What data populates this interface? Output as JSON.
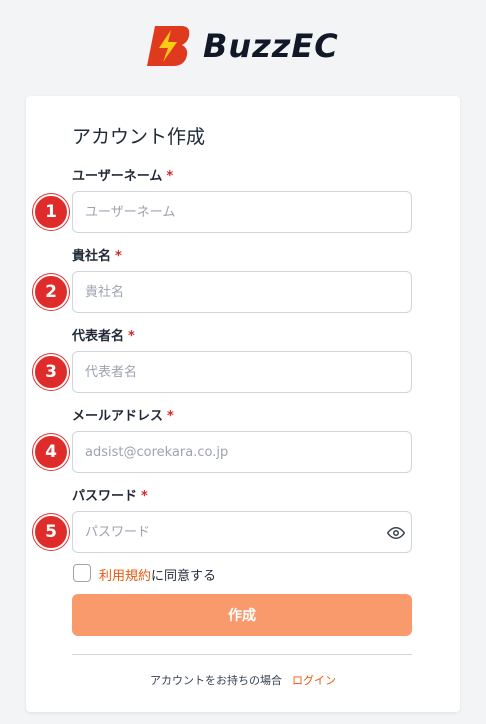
{
  "brand": {
    "name": "BuzzEC",
    "accent_color": "#e03a1e",
    "bolt_color": "#facc15"
  },
  "form": {
    "title": "アカウント作成",
    "required_mark": "*",
    "fields": [
      {
        "badge": "1",
        "label": "ユーザーネーム",
        "placeholder": "ユーザーネーム",
        "value": ""
      },
      {
        "badge": "2",
        "label": "貴社名",
        "placeholder": "貴社名",
        "value": ""
      },
      {
        "badge": "3",
        "label": "代表者名",
        "placeholder": "代表者名",
        "value": ""
      },
      {
        "badge": "4",
        "label": "メールアドレス",
        "placeholder": "adsist@corekara.co.jp",
        "value": ""
      },
      {
        "badge": "5",
        "label": "パスワード",
        "placeholder": "パスワード",
        "value": "",
        "toggle_icon": "eye-icon"
      }
    ],
    "agreement": {
      "link_text": "利用規約",
      "suffix": "に同意する",
      "checked": false
    },
    "submit_label": "作成",
    "submit_color": "#f89a6b"
  },
  "footer": {
    "prompt": "アカウントをお持ちの場合",
    "login_label": "ログイン"
  }
}
